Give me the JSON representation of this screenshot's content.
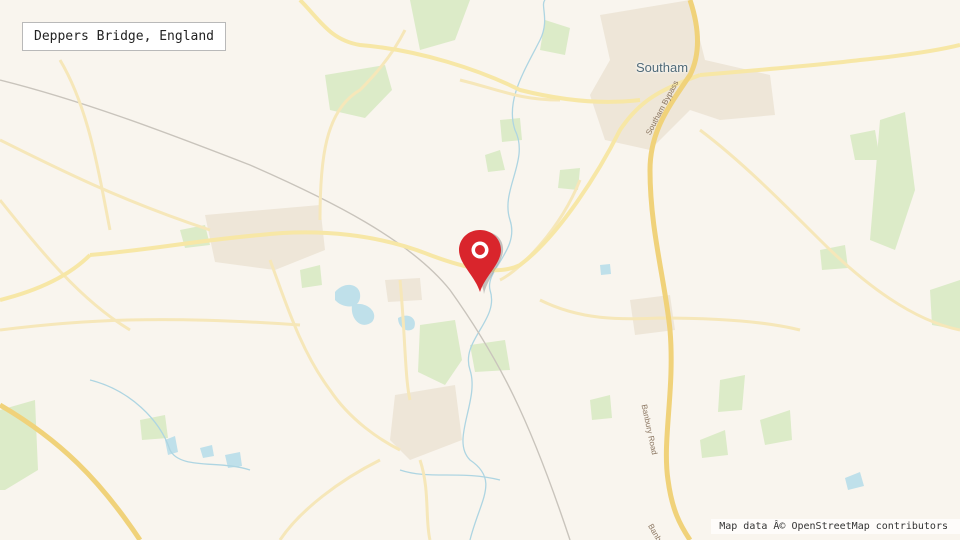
{
  "location_label": "Deppers Bridge, England",
  "attribution": "Map data Â© OpenStreetMap contributors",
  "places": {
    "town": "Southam"
  },
  "roads": {
    "bypass": "Southam Bypass",
    "banbury_1": "Banbury Road",
    "banbury_2": "Banbury R"
  },
  "colors": {
    "background": "#f9f5ee",
    "woodland": "#dcebc8",
    "road_major": "#f3dc90",
    "road_minor": "#fbf0cc",
    "water": "#bfe0ea",
    "marker": "#d9252c"
  },
  "marker_icon": "map-pin-icon"
}
